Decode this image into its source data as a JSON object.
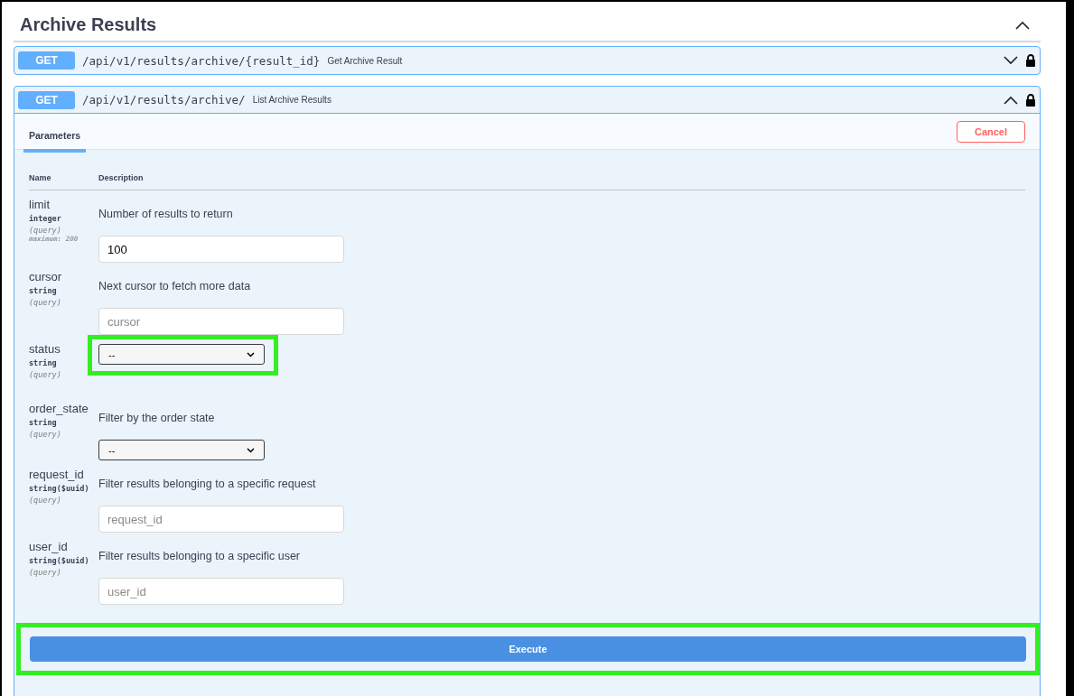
{
  "section": {
    "title": "Archive Results",
    "expanded": true
  },
  "operations": [
    {
      "method": "GET",
      "path": "/api/v1/results/archive/{result_id}",
      "summary": "Get Archive Result",
      "expanded": false,
      "locked": true
    },
    {
      "method": "GET",
      "path": "/api/v1/results/archive/",
      "summary": "List Archive Results",
      "expanded": true,
      "locked": true
    }
  ],
  "tabs": [
    {
      "label": "Parameters",
      "selected": true
    }
  ],
  "cancel_button": "Cancel",
  "table": {
    "columns": [
      "Name",
      "Description"
    ],
    "parameters": [
      {
        "name": "limit",
        "type": "integer",
        "location": "(query)",
        "constraint": "maximum: 200",
        "description": "Number of results to return",
        "input": {
          "kind": "text",
          "value": "100"
        },
        "highlighted": false
      },
      {
        "name": "cursor",
        "type": "string",
        "location": "(query)",
        "description": "Next cursor to fetch more data",
        "input": {
          "kind": "text",
          "placeholder": "cursor"
        },
        "highlighted": false
      },
      {
        "name": "status",
        "type": "string",
        "location": "(query)",
        "input": {
          "kind": "select",
          "value": "--"
        },
        "highlighted": true
      },
      {
        "name": "order_state",
        "type": "string",
        "location": "(query)",
        "description": "Filter by the order state",
        "input": {
          "kind": "select",
          "value": "--"
        },
        "highlighted": false
      },
      {
        "name": "request_id",
        "type": "string($uuid)",
        "location": "(query)",
        "description": "Filter results belonging to a specific request",
        "input": {
          "kind": "text",
          "placeholder": "request_id"
        },
        "highlighted": false
      },
      {
        "name": "user_id",
        "type": "string($uuid)",
        "location": "(query)",
        "description": "Filter results belonging to a specific user",
        "input": {
          "kind": "text",
          "placeholder": "user_id"
        },
        "highlighted": false
      }
    ]
  },
  "execute": {
    "label": "Execute",
    "highlighted": true
  }
}
